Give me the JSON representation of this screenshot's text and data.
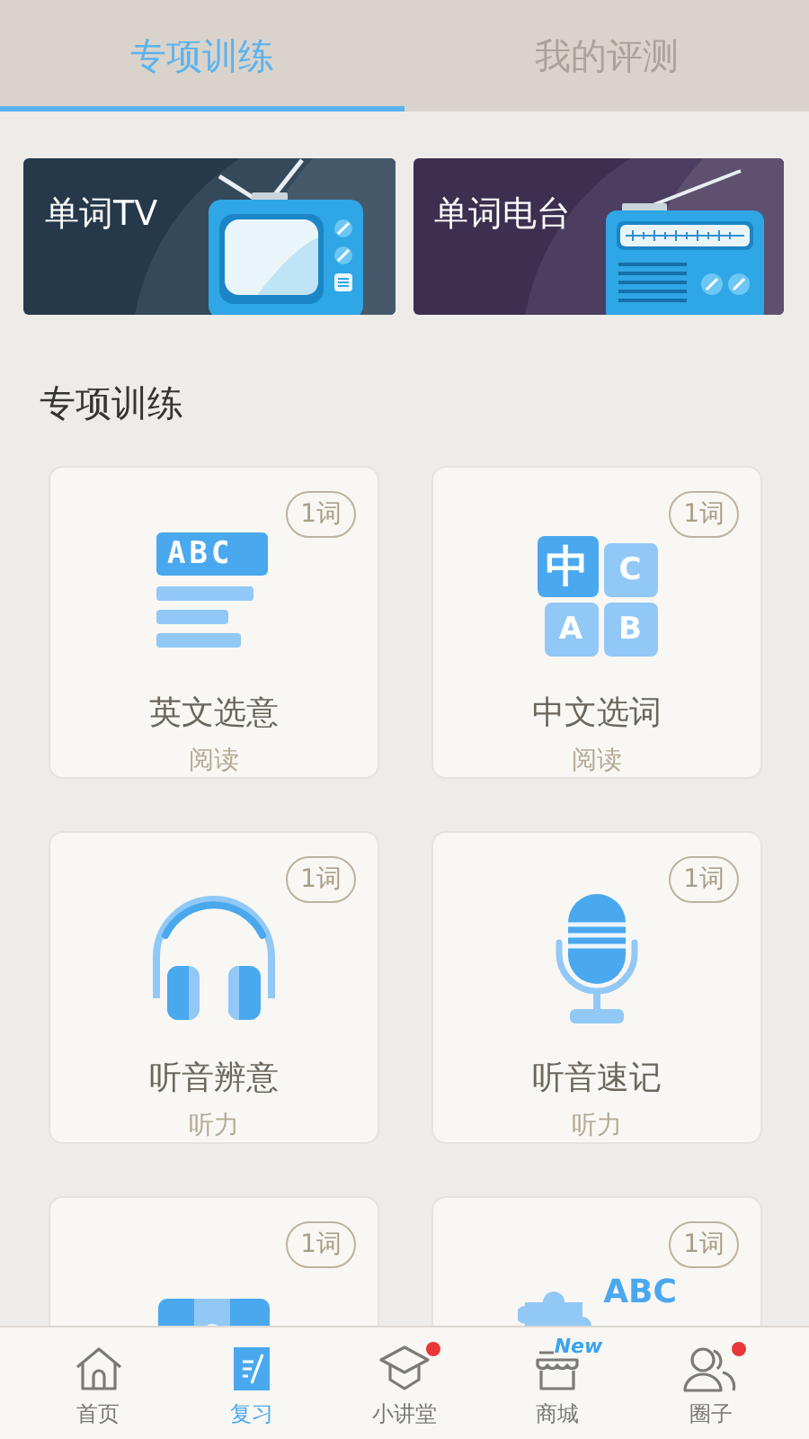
{
  "tabs": [
    {
      "label": "专项训练",
      "selected": true
    },
    {
      "label": "我的评测",
      "selected": false
    }
  ],
  "banners": [
    {
      "title": "单词TV",
      "kind": "tv"
    },
    {
      "title": "单词电台",
      "kind": "radio"
    }
  ],
  "section_title": "专项训练",
  "cards": [
    {
      "kind": "abc-lines",
      "icon_texts": [
        "ABC"
      ],
      "title": "英文选意",
      "subtitle": "阅读",
      "badge": "1词"
    },
    {
      "kind": "tiles",
      "icon_texts": [
        "中",
        "C",
        "A",
        "B"
      ],
      "title": "中文选词",
      "subtitle": "阅读",
      "badge": "1词"
    },
    {
      "kind": "headphones",
      "title": "听音辨意",
      "subtitle": "听力",
      "badge": "1词"
    },
    {
      "kind": "microphone",
      "title": "听音速记",
      "subtitle": "听力",
      "badge": "1词"
    },
    {
      "kind": "puzzle-box",
      "badge": "1词"
    },
    {
      "kind": "puzzle-abc",
      "icon_texts": [
        "ABC"
      ],
      "badge": "1词"
    }
  ],
  "bottom_nav": [
    {
      "label": "首页",
      "kind": "home",
      "selected": false,
      "dot": false
    },
    {
      "label": "复习",
      "kind": "note",
      "selected": true,
      "dot": false
    },
    {
      "label": "小讲堂",
      "kind": "cap",
      "selected": false,
      "dot": true
    },
    {
      "label": "商城",
      "kind": "shop",
      "selected": false,
      "dot": false,
      "tag": "New"
    },
    {
      "label": "圈子",
      "kind": "people",
      "selected": false,
      "dot": true
    }
  ]
}
